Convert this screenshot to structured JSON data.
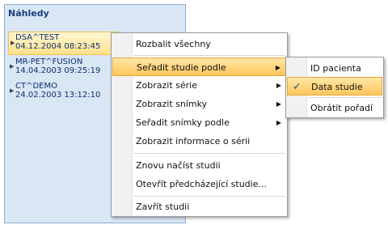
{
  "panel": {
    "title": "Náhledy"
  },
  "studies": [
    {
      "name": "DSA^TEST",
      "date": "04.12.2004 08:23:45"
    },
    {
      "name": "MR-PET^FUSION",
      "date": "14.04.2003 09:25:19"
    },
    {
      "name": "CT^DEMO",
      "date": "24.02.2003 13:12:10"
    }
  ],
  "context_menu": {
    "items": [
      {
        "label": "Rozbalit všechny"
      },
      {
        "label": "Seřadit studie podle",
        "submenu": true
      },
      {
        "label": "Zobrazit série",
        "submenu": true
      },
      {
        "label": "Zobrazit snímky",
        "submenu": true
      },
      {
        "label": "Seřadit snímky podle",
        "submenu": true
      },
      {
        "label": "Zobrazit informace o sérii"
      },
      {
        "label": "Znovu načíst studii"
      },
      {
        "label": "Otevřít předcházející studie..."
      },
      {
        "label": "Zavřít studii"
      }
    ]
  },
  "sort_submenu": {
    "items": [
      {
        "label": "ID pacienta",
        "checked": false
      },
      {
        "label": "Data studie",
        "checked": true
      },
      {
        "label": "Obrátit pořadí",
        "checked": false
      }
    ]
  },
  "glyphs": {
    "expand_arrow": "▶",
    "submenu_arrow": "▶",
    "checkmark": "✓"
  }
}
